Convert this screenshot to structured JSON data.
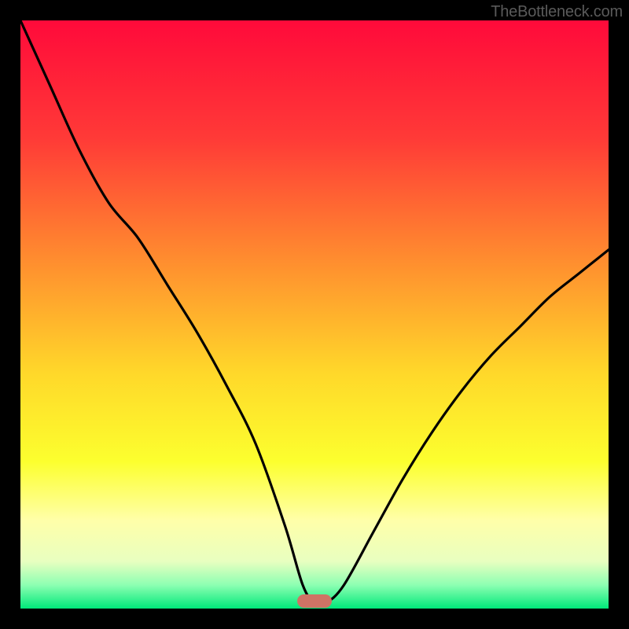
{
  "watermark": "TheBottleneck.com",
  "chart_data": {
    "type": "line",
    "title": "",
    "xlabel": "",
    "ylabel": "",
    "xlim": [
      0,
      100
    ],
    "ylim": [
      0,
      100
    ],
    "grid": false,
    "series": [
      {
        "name": "bottleneck-curve",
        "x": [
          0,
          5,
          10,
          15,
          20,
          25,
          30,
          35,
          40,
          45,
          48,
          50,
          52,
          55,
          60,
          65,
          70,
          75,
          80,
          85,
          90,
          95,
          100
        ],
        "y": [
          100,
          89,
          78,
          69,
          63,
          55,
          47,
          38,
          28,
          14,
          4,
          1,
          1,
          4,
          13,
          22,
          30,
          37,
          43,
          48,
          53,
          57,
          61
        ]
      }
    ],
    "background_gradient": {
      "stops": [
        {
          "offset": 0.0,
          "color": "#ff0a3a"
        },
        {
          "offset": 0.2,
          "color": "#ff3a37"
        },
        {
          "offset": 0.4,
          "color": "#ff8a2f"
        },
        {
          "offset": 0.6,
          "color": "#ffd82a"
        },
        {
          "offset": 0.75,
          "color": "#fcff2e"
        },
        {
          "offset": 0.85,
          "color": "#ffffa9"
        },
        {
          "offset": 0.92,
          "color": "#e8ffc0"
        },
        {
          "offset": 0.96,
          "color": "#8dffb2"
        },
        {
          "offset": 1.0,
          "color": "#00e87a"
        }
      ]
    },
    "marker": {
      "name": "optimal-zone-pill",
      "x_center": 50,
      "y": 0,
      "width_pct": 6,
      "color": "#cf7365"
    }
  }
}
